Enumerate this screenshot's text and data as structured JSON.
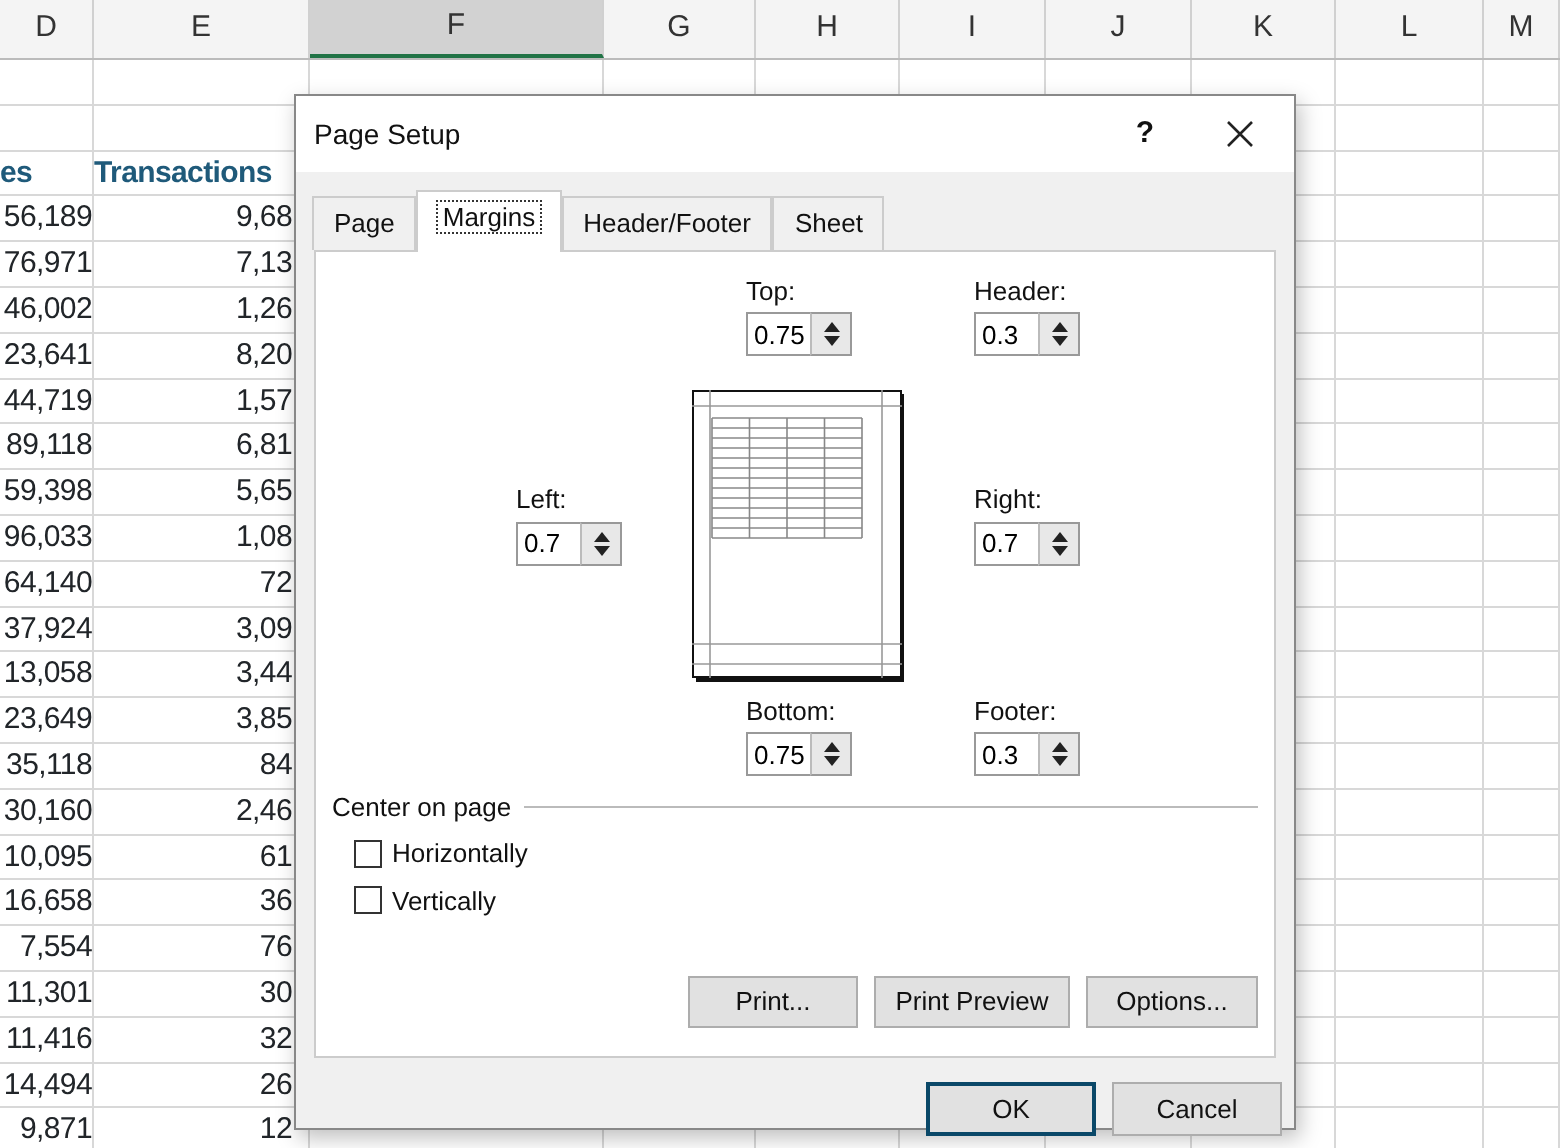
{
  "sheet": {
    "column_headers": [
      {
        "label": "D",
        "selected": false
      },
      {
        "label": "E",
        "selected": false
      },
      {
        "label": "F",
        "selected": true
      },
      {
        "label": "G",
        "selected": false
      },
      {
        "label": "H",
        "selected": false
      },
      {
        "label": "I",
        "selected": false
      },
      {
        "label": "J",
        "selected": false
      },
      {
        "label": "K",
        "selected": false
      },
      {
        "label": "L",
        "selected": false
      },
      {
        "label": "M",
        "selected": false
      }
    ],
    "table_header": [
      "es",
      "Transactions"
    ],
    "rows": [
      {
        "column_d": "56,189",
        "column_e": "9,68"
      },
      {
        "column_d": "76,971",
        "column_e": "7,13"
      },
      {
        "column_d": "46,002",
        "column_e": "1,26"
      },
      {
        "column_d": "23,641",
        "column_e": "8,20"
      },
      {
        "column_d": "44,719",
        "column_e": "1,57"
      },
      {
        "column_d": "89,118",
        "column_e": "6,81"
      },
      {
        "column_d": "59,398",
        "column_e": "5,65"
      },
      {
        "column_d": "96,033",
        "column_e": "1,08"
      },
      {
        "column_d": "64,140",
        "column_e": "72"
      },
      {
        "column_d": "37,924",
        "column_e": "3,09"
      },
      {
        "column_d": "13,058",
        "column_e": "3,44"
      },
      {
        "column_d": "23,649",
        "column_e": "3,85"
      },
      {
        "column_d": "35,118",
        "column_e": "84"
      },
      {
        "column_d": "30,160",
        "column_e": "2,46"
      },
      {
        "column_d": "10,095",
        "column_e": "61"
      },
      {
        "column_d": "16,658",
        "column_e": "36"
      },
      {
        "column_d": "7,554",
        "column_e": "76"
      },
      {
        "column_d": "11,301",
        "column_e": "30"
      },
      {
        "column_d": "11,416",
        "column_e": "32"
      },
      {
        "column_d": "14,494",
        "column_e": "26"
      },
      {
        "column_d": "9,871",
        "column_e": "12"
      }
    ]
  },
  "dialog": {
    "title": "Page Setup",
    "help": "?",
    "tabs": [
      {
        "label": "Page",
        "selected": false
      },
      {
        "label": "Margins",
        "selected": true
      },
      {
        "label": "Header/Footer",
        "selected": false
      },
      {
        "label": "Sheet",
        "selected": false
      }
    ],
    "margins": {
      "top": {
        "label": "Top:",
        "value": "0.75"
      },
      "header": {
        "label": "Header:",
        "value": "0.3"
      },
      "left": {
        "label": "Left:",
        "value": "0.7"
      },
      "right": {
        "label": "Right:",
        "value": "0.7"
      },
      "bottom": {
        "label": "Bottom:",
        "value": "0.75"
      },
      "footer": {
        "label": "Footer:",
        "value": "0.3"
      }
    },
    "center_on_page": {
      "title": "Center on page",
      "options": [
        {
          "label": "Horizontally",
          "checked": false
        },
        {
          "label": "Vertically",
          "checked": false
        }
      ]
    },
    "panel_buttons": [
      "Print...",
      "Print Preview",
      "Options..."
    ],
    "buttons": [
      {
        "label": "OK",
        "default": true
      },
      {
        "label": "Cancel",
        "default": false
      }
    ]
  }
}
